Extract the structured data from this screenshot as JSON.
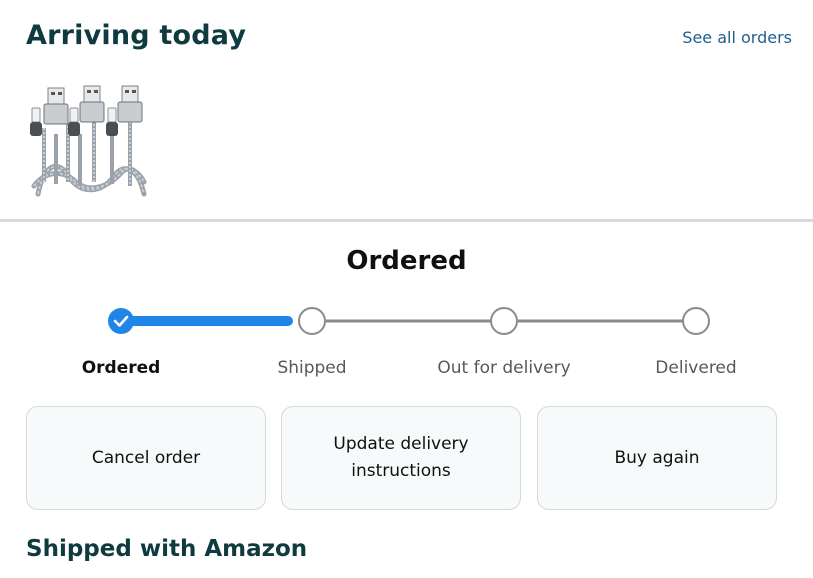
{
  "header": {
    "title": "Arriving today",
    "see_all_label": "See all orders"
  },
  "product": {
    "icon": "lightning-cable-product-image"
  },
  "status": {
    "title": "Ordered",
    "current_step_index": 0,
    "steps": [
      {
        "label": "Ordered",
        "state": "complete"
      },
      {
        "label": "Shipped",
        "state": "pending"
      },
      {
        "label": "Out for delivery",
        "state": "pending"
      },
      {
        "label": "Delivered",
        "state": "pending"
      }
    ]
  },
  "actions": [
    {
      "label": "Cancel order"
    },
    {
      "label": "Update delivery instructions"
    },
    {
      "label": "Buy again"
    }
  ],
  "shipping": {
    "heading": "Shipped with Amazon"
  },
  "colors": {
    "accent_progress": "#1f86e8",
    "heading_teal": "#0f3a3f",
    "link_blue": "#1f5f8f",
    "track_gray": "#8a8a8a"
  }
}
